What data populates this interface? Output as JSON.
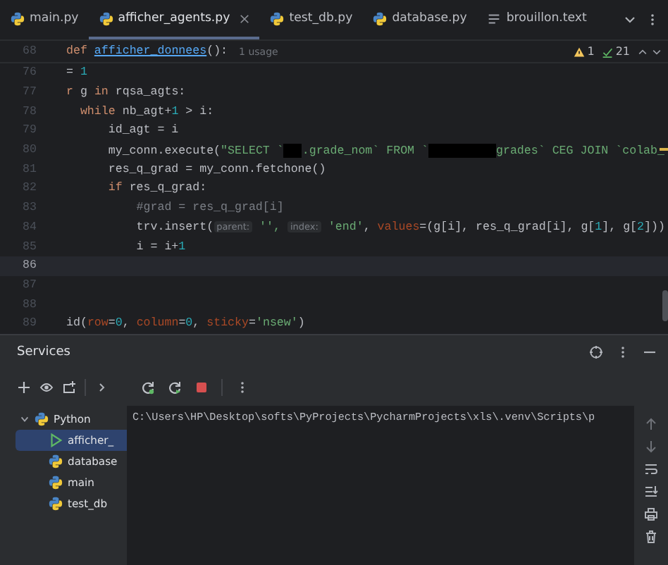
{
  "tabs": [
    {
      "label": "main.py",
      "kind": "python",
      "selected": false,
      "closable": false
    },
    {
      "label": "afficher_agents.py",
      "kind": "python",
      "selected": true,
      "closable": true
    },
    {
      "label": "test_db.py",
      "kind": "python",
      "selected": false,
      "closable": false
    },
    {
      "label": "database.py",
      "kind": "python",
      "selected": false,
      "closable": false
    },
    {
      "label": "brouillon.text",
      "kind": "text",
      "selected": false,
      "closable": false
    }
  ],
  "inspections": {
    "warnings": "1",
    "checks": "21"
  },
  "sticky_line": {
    "number": "68",
    "tokens": [
      {
        "kind": "kw",
        "text": "def "
      },
      {
        "kind": "fn",
        "text": "afficher_donnees"
      },
      {
        "kind": "plain",
        "text": "():"
      }
    ],
    "usage_hint": "1 usage"
  },
  "lines": [
    {
      "number": "76",
      "current": false,
      "tokens": [
        {
          "kind": "plain",
          "text": "= "
        },
        {
          "kind": "num",
          "text": "1"
        }
      ]
    },
    {
      "number": "77",
      "current": false,
      "tokens": [
        {
          "kind": "kw",
          "text": "r "
        },
        {
          "kind": "plain",
          "text": "g "
        },
        {
          "kind": "kw",
          "text": "in "
        },
        {
          "kind": "plain",
          "text": "rqsa_agts:"
        }
      ]
    },
    {
      "number": "78",
      "current": false,
      "tokens": [
        {
          "kind": "kw",
          "text": "  while "
        },
        {
          "kind": "plain",
          "text": "nb_agt+"
        },
        {
          "kind": "num",
          "text": "1"
        },
        {
          "kind": "plain",
          "text": " > i:"
        }
      ]
    },
    {
      "number": "79",
      "current": false,
      "tokens": [
        {
          "kind": "plain",
          "text": "      id_agt = i"
        }
      ]
    },
    {
      "number": "80",
      "current": false,
      "tokens": [
        {
          "kind": "plain",
          "text": "      my_conn.execute("
        },
        {
          "kind": "str",
          "text": "\"SELECT `"
        },
        {
          "kind": "mask"
        },
        {
          "kind": "str",
          "text": ".grade_nom` FROM `"
        },
        {
          "kind": "long_mask"
        },
        {
          "kind": "str",
          "text": "grades` CEG JOIN `colab_"
        }
      ]
    },
    {
      "number": "81",
      "current": false,
      "tokens": [
        {
          "kind": "plain",
          "text": "      res_q_grad = my_conn.fetchone()"
        }
      ]
    },
    {
      "number": "82",
      "current": false,
      "tokens": [
        {
          "kind": "kw",
          "text": "      if "
        },
        {
          "kind": "plain",
          "text": "res_q_grad:"
        }
      ]
    },
    {
      "number": "83",
      "current": false,
      "tokens": [
        {
          "kind": "comment",
          "text": "          #grad = res_q_grad[i]"
        }
      ]
    },
    {
      "number": "84",
      "current": false,
      "tokens": [
        {
          "kind": "plain",
          "text": "          trv.insert("
        },
        {
          "kind": "hint",
          "text": "parent:"
        },
        {
          "kind": "str",
          "text": " '', "
        },
        {
          "kind": "hint",
          "text": "index:"
        },
        {
          "kind": "str",
          "text": " 'end'"
        },
        {
          "kind": "plain",
          "text": ", "
        },
        {
          "kind": "param",
          "text": "values"
        },
        {
          "kind": "plain",
          "text": "=(g[i], res_q_grad[i], g["
        },
        {
          "kind": "num",
          "text": "1"
        },
        {
          "kind": "plain",
          "text": "], g["
        },
        {
          "kind": "num",
          "text": "2"
        },
        {
          "kind": "plain",
          "text": "]))"
        }
      ]
    },
    {
      "number": "85",
      "current": false,
      "tokens": [
        {
          "kind": "plain",
          "text": "          i = i+"
        },
        {
          "kind": "num",
          "text": "1"
        }
      ]
    },
    {
      "number": "86",
      "current": true
    },
    {
      "number": "87",
      "current": false
    },
    {
      "number": "88",
      "current": false
    },
    {
      "number": "89",
      "current": false,
      "tokens": [
        {
          "kind": "plain",
          "text": "id("
        },
        {
          "kind": "param",
          "text": "row"
        },
        {
          "kind": "plain",
          "text": "="
        },
        {
          "kind": "num",
          "text": "0"
        },
        {
          "kind": "plain",
          "text": ", "
        },
        {
          "kind": "param",
          "text": "column"
        },
        {
          "kind": "plain",
          "text": "="
        },
        {
          "kind": "num",
          "text": "0"
        },
        {
          "kind": "plain",
          "text": ", "
        },
        {
          "kind": "param",
          "text": "sticky"
        },
        {
          "kind": "plain",
          "text": "="
        },
        {
          "kind": "str",
          "text": "'nsew'"
        },
        {
          "kind": "plain",
          "text": ")"
        }
      ]
    }
  ],
  "services": {
    "title": "Services",
    "tree": [
      {
        "label": "Python",
        "kind": "python",
        "expanded": true,
        "selected": false,
        "children": [
          {
            "label": "afficher_",
            "kind": "run",
            "selected": true
          },
          {
            "label": "database",
            "kind": "python",
            "selected": false
          },
          {
            "label": "main",
            "kind": "python",
            "selected": false
          },
          {
            "label": "test_db",
            "kind": "python",
            "selected": false
          }
        ]
      }
    ],
    "console": [
      "C:\\Users\\HP\\Desktop\\softs\\PyProjects\\PycharmProjects\\xls\\.venv\\Scripts\\p"
    ]
  }
}
